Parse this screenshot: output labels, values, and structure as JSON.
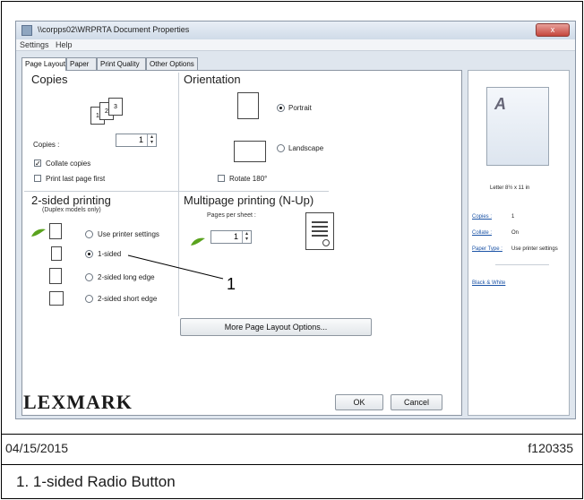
{
  "window": {
    "title": "\\\\corpps02\\WRPRTA Document Properties",
    "close_label": "x"
  },
  "menu": [
    "Settings",
    "Help"
  ],
  "tabs": [
    "Page Layout",
    "Paper",
    "Print Quality",
    "Other Options"
  ],
  "copies": {
    "title": "Copies",
    "count_label": "Copies :",
    "count_value": "1",
    "collate_label": "Collate copies",
    "collate_checked": true,
    "print_last_first_label": "Print last page first",
    "print_last_first_checked": false,
    "icon_digits": [
      "1",
      "2",
      "3"
    ]
  },
  "orientation": {
    "title": "Orientation",
    "portrait_label": "Portrait",
    "landscape_label": "Landscape",
    "selected": "portrait",
    "rotate_label": "Rotate 180°",
    "rotate_checked": false
  },
  "duplex": {
    "title": "2-sided printing",
    "subtitle": "(Duplex models only)",
    "options": [
      "Use printer settings",
      "1-sided",
      "2-sided long edge",
      "2-sided short edge"
    ],
    "selected_index": 1
  },
  "nup": {
    "title": "Multipage printing (N-Up)",
    "pages_per_sheet_label": "Pages per sheet :",
    "pages_per_sheet_value": "1"
  },
  "more_options_button": "More Page Layout Options...",
  "preview": {
    "page_letter": "A",
    "paper_caption": "Letter 8½ x 11 in",
    "rows": [
      {
        "label": "Copies :",
        "value": "1"
      },
      {
        "label": "Collate :",
        "value": "On"
      },
      {
        "label": "Paper Type :",
        "value": "Use printer settings"
      }
    ],
    "color_link": "Black & White"
  },
  "brand": "LEXMARK",
  "buttons": {
    "ok": "OK",
    "cancel": "Cancel"
  },
  "callout_number": "1",
  "footer": {
    "date": "04/15/2015",
    "figure_id": "f120335"
  },
  "caption": "1.  1-sided Radio Button",
  "colors": {
    "accent_green": "#5aa31e",
    "link_blue": "#1b53a6"
  }
}
